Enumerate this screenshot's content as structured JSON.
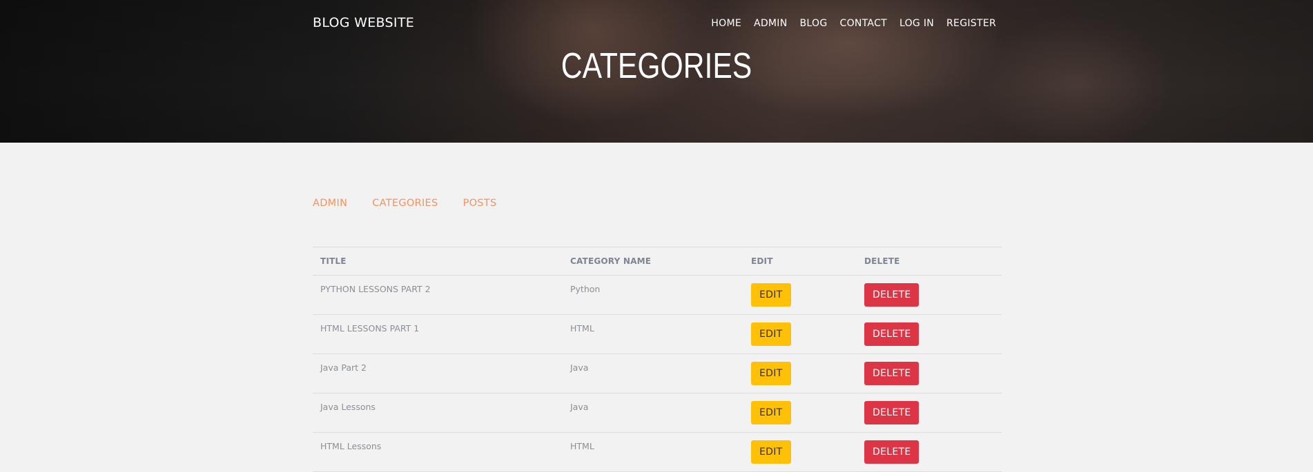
{
  "header": {
    "brand": "BLOG WEBSITE",
    "nav": [
      "HOME",
      "ADMIN",
      "BLOG",
      "CONTACT",
      "LOG IN",
      "REGISTER"
    ],
    "page_title": "CATEGORIES"
  },
  "subnav": [
    "ADMIN",
    "CATEGORIES",
    "POSTS"
  ],
  "table": {
    "columns": [
      "TITLE",
      "CATEGORY NAME",
      "EDIT",
      "DELETE"
    ],
    "rows": [
      {
        "title": "PYTHON LESSONS PART 2",
        "category": "Python",
        "edit": "EDIT",
        "delete": "DELETE"
      },
      {
        "title": "HTML LESSONS PART 1",
        "category": "HTML",
        "edit": "EDIT",
        "delete": "DELETE"
      },
      {
        "title": "Java Part 2",
        "category": "Java",
        "edit": "EDIT",
        "delete": "DELETE"
      },
      {
        "title": "Java Lessons",
        "category": "Java",
        "edit": "EDIT",
        "delete": "DELETE"
      },
      {
        "title": "HTML Lessons",
        "category": "HTML",
        "edit": "EDIT",
        "delete": "DELETE"
      }
    ]
  },
  "colors": {
    "edit_button": "#ffc107",
    "delete_button": "#dc3545",
    "subnav_link": "#f0935e",
    "page_background": "#f2f2f2"
  }
}
